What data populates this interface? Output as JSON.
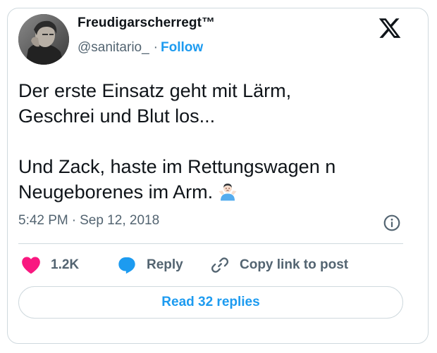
{
  "author": {
    "display_name": "Freudigarscherregt™",
    "handle": "@sanitario_",
    "separator": "·",
    "follow_label": "Follow",
    "avatar_icon": "profile-photo"
  },
  "platform_icon": "x-logo-icon",
  "tweet": {
    "lines_para1": [
      "Der erste Einsatz geht mit Lärm,",
      "Geschrei und Blut los..."
    ],
    "lines_para2": [
      "Und Zack, haste im Rettungswagen n",
      "Neugeborenes im Arm."
    ],
    "emoji": "person-shrugging-emoji"
  },
  "meta": {
    "time": "5:42 PM",
    "separator": "·",
    "date": "Sep 12, 2018",
    "info_icon": "info-icon"
  },
  "actions": {
    "like_count": "1.2K",
    "reply_label": "Reply",
    "copy_label": "Copy link to post"
  },
  "read_replies_label": "Read 32 replies",
  "colors": {
    "accent": "#1d9bf0",
    "like": "#f91880",
    "text": "#0f1419",
    "muted": "#536471",
    "border": "#cfd9de"
  }
}
